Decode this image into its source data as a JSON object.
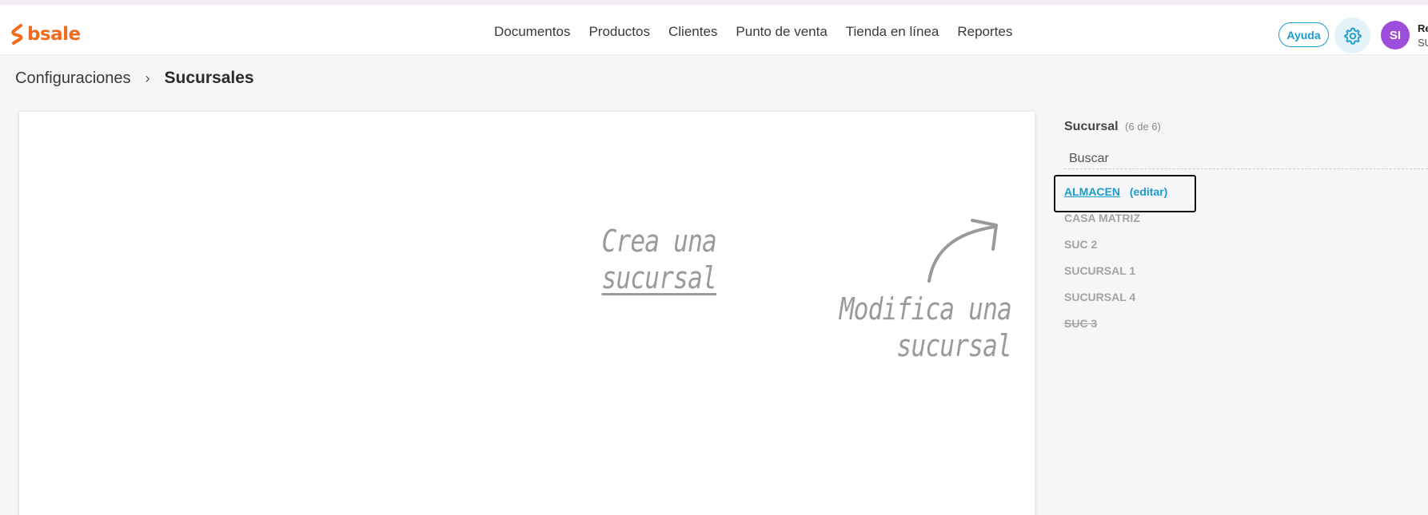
{
  "header": {
    "logo_text": "bsale",
    "nav": [
      "Documentos",
      "Productos",
      "Clientes",
      "Punto de venta",
      "Tienda en línea",
      "Reportes"
    ],
    "help_label": "Ayuda",
    "avatar_initials": "SI",
    "user_name": "Re",
    "user_sub": "SU"
  },
  "breadcrumb": {
    "parent": "Configuraciones",
    "separator": "›",
    "current": "Sucursales"
  },
  "main": {
    "create_line1": "Crea una",
    "create_line2": "sucursal",
    "modify_line1": "Modifica una",
    "modify_line2": "sucursal"
  },
  "sidebar": {
    "title": "Sucursal",
    "count": "(6 de 6)",
    "search_placeholder": "Buscar",
    "edit_label": "(editar)",
    "branches": [
      {
        "name": "ALMACEN",
        "state": "active"
      },
      {
        "name": "CASA MATRIZ",
        "state": "normal"
      },
      {
        "name": "SUC 2",
        "state": "normal"
      },
      {
        "name": "SUCURSAL 1",
        "state": "normal"
      },
      {
        "name": "SUCURSAL 4",
        "state": "normal"
      },
      {
        "name": "SUC 3",
        "state": "disabled"
      }
    ]
  },
  "colors": {
    "brand": "#f26a1b",
    "accent": "#1a9bcf",
    "avatar": "#9d4edd"
  }
}
